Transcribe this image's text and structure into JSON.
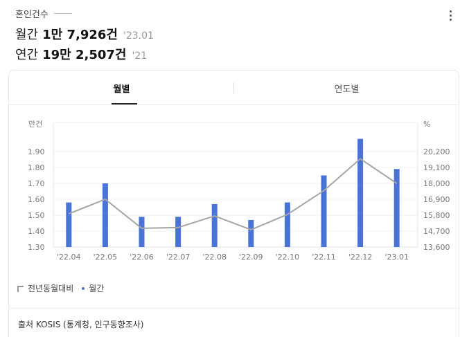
{
  "header": {
    "title": "혼인건수",
    "monthly_label": "월간",
    "monthly_value": "1만 7,926건",
    "monthly_date": "'23.01",
    "yearly_label": "연간",
    "yearly_value": "19만 2,507건",
    "yearly_date": "'21"
  },
  "tabs": [
    {
      "label": "월별"
    },
    {
      "label": "연도별"
    }
  ],
  "legend": {
    "line_label": "전년동월대비",
    "bar_label": "월간"
  },
  "source": "출처 KOSIS (통계청, 인구동향조사)",
  "colors": {
    "bar": "#4a73d7",
    "line": "#a5a5a5"
  },
  "chart_data": {
    "type": "bar",
    "left_unit": "만건",
    "right_unit": "%",
    "categories": [
      "'22.04",
      "'22.05",
      "'22.06",
      "'22.07",
      "'22.08",
      "'22.09",
      "'22.10",
      "'22.11",
      "'22.12",
      "'23.01"
    ],
    "left_ticks": [
      "1.90",
      "1.80",
      "1.70",
      "1.60",
      "1.50",
      "1.40",
      "1.30"
    ],
    "right_ticks": [
      "20,200",
      "19,100",
      "18,000",
      "16,900",
      "15,800",
      "14,700",
      "13,600"
    ],
    "ylim_left": [
      1.3,
      1.9
    ],
    "ylim_right": [
      13600,
      20200
    ],
    "series": [
      {
        "name": "월간",
        "type": "bar",
        "axis": "left",
        "values": [
          1.58,
          1.7,
          1.49,
          1.49,
          1.57,
          1.47,
          1.58,
          1.75,
          1.98,
          1.79
        ]
      },
      {
        "name": "전년동월대비",
        "type": "line",
        "axis": "right",
        "values": [
          15900,
          16900,
          14900,
          14950,
          15750,
          14800,
          15850,
          17500,
          19700,
          18000
        ]
      }
    ],
    "grid": true,
    "legend_position": "bottom-left"
  }
}
